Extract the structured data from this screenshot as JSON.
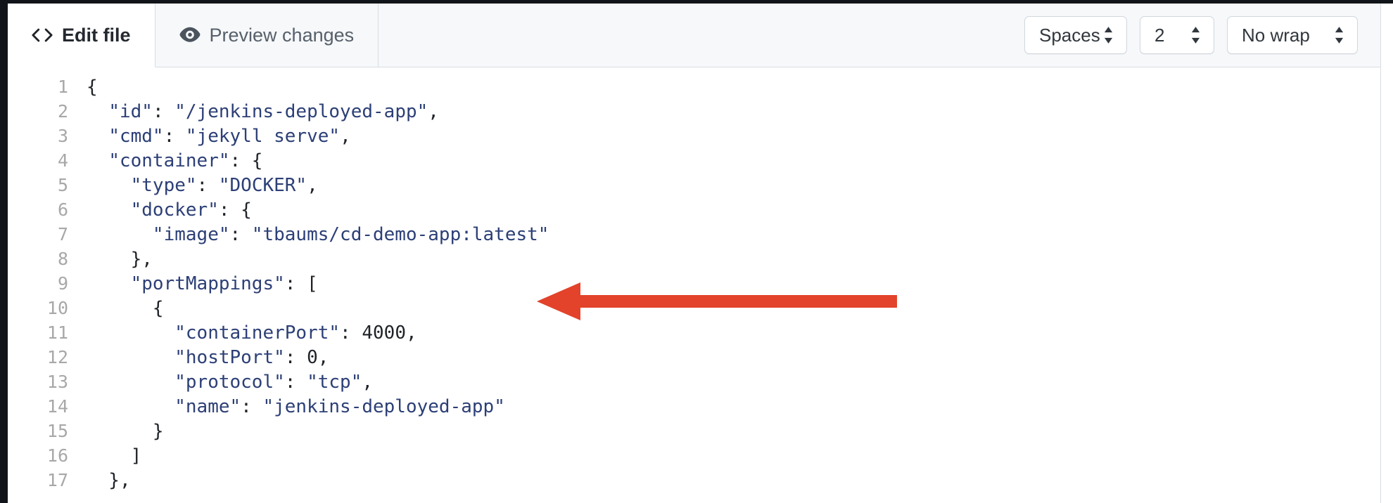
{
  "editor": {
    "tabs": [
      {
        "id": "edit-file",
        "label": "Edit file",
        "icon": "code-icon",
        "active": true
      },
      {
        "id": "preview-changes",
        "label": "Preview changes",
        "icon": "eye-icon",
        "active": false
      }
    ],
    "controls": [
      {
        "id": "indent-mode",
        "name": "indent-mode-select",
        "value": "Spaces",
        "icon": "chevron-updown-icon"
      },
      {
        "id": "indent-size",
        "name": "indent-size-select",
        "value": "2",
        "icon": "chevron-updown-icon"
      },
      {
        "id": "wrap-mode",
        "name": "wrap-mode-select",
        "value": "No wrap",
        "icon": "chevron-updown-icon"
      }
    ]
  },
  "code": {
    "language": "json",
    "lines": [
      {
        "n": "1",
        "text": "{"
      },
      {
        "n": "2",
        "text": "  \"id\": \"/jenkins-deployed-app\","
      },
      {
        "n": "3",
        "text": "  \"cmd\": \"jekyll serve\","
      },
      {
        "n": "4",
        "text": "  \"container\": {"
      },
      {
        "n": "5",
        "text": "    \"type\": \"DOCKER\","
      },
      {
        "n": "6",
        "text": "    \"docker\": {"
      },
      {
        "n": "7",
        "text": "      \"image\": \"tbaums/cd-demo-app:latest\""
      },
      {
        "n": "8",
        "text": "    },"
      },
      {
        "n": "9",
        "text": "    \"portMappings\": ["
      },
      {
        "n": "10",
        "text": "      {"
      },
      {
        "n": "11",
        "text": "        \"containerPort\": 4000,"
      },
      {
        "n": "12",
        "text": "        \"hostPort\": 0,"
      },
      {
        "n": "13",
        "text": "        \"protocol\": \"tcp\","
      },
      {
        "n": "14",
        "text": "        \"name\": \"jenkins-deployed-app\""
      },
      {
        "n": "15",
        "text": "      }"
      },
      {
        "n": "16",
        "text": "    ]"
      },
      {
        "n": "17",
        "text": "  },"
      }
    ]
  },
  "annotation": {
    "name": "red-arrow-annotation",
    "points_to_line": "7",
    "direction": "left",
    "color": "#E2432A"
  },
  "colors": {
    "accent_red": "#E2432A",
    "string_blue": "#2C3F76",
    "header_bg": "#F6F8FA",
    "border": "#D8DEE4",
    "line_number": "#A8A8A8",
    "text": "#1F2328"
  }
}
